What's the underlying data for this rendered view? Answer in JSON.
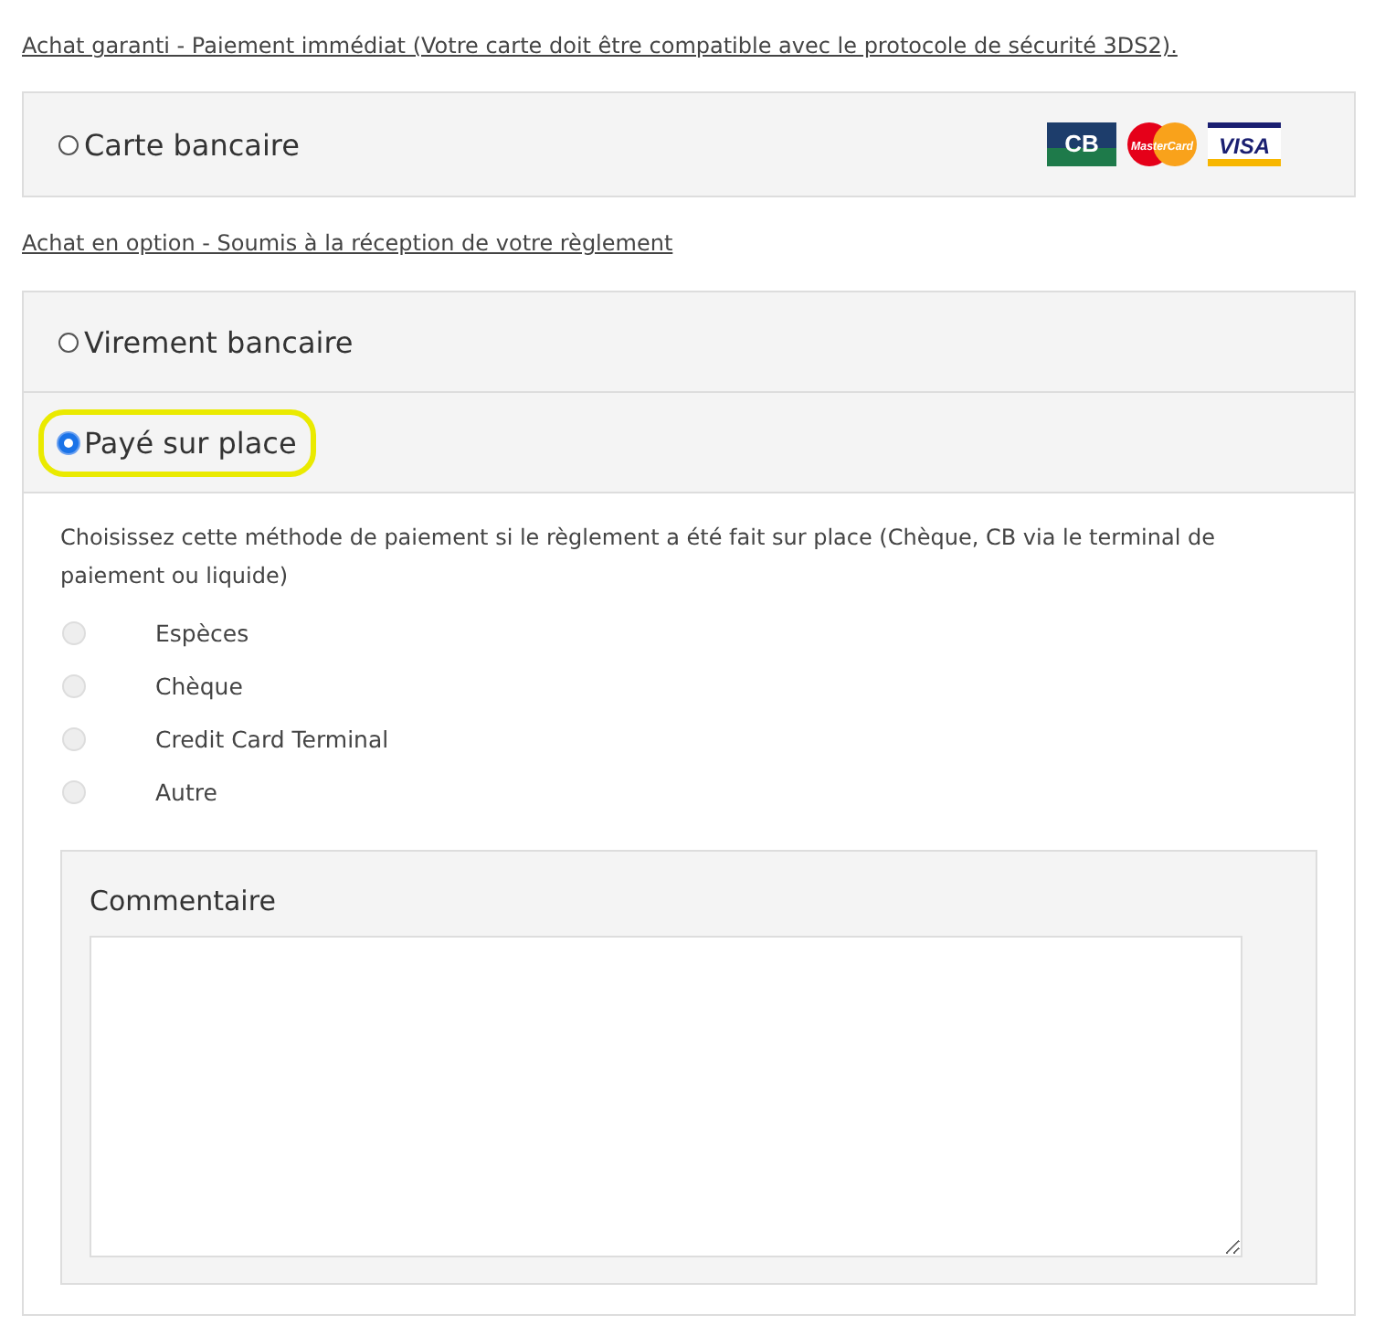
{
  "guaranteed_link": "Achat garanti - Paiement immédiat (Votre carte doit être compatible avec le protocole de sécurité 3DS2).",
  "card_option": {
    "label": "Carte bancaire",
    "selected": false,
    "logos": [
      {
        "kind": "cb",
        "text": "CB"
      },
      {
        "kind": "mastercard",
        "text": "MasterCard"
      },
      {
        "kind": "visa",
        "text": "VISA"
      }
    ]
  },
  "optional_link": "Achat en option - Soumis à la réception de votre règlement",
  "methods": [
    {
      "label": "Virement bancaire",
      "selected": false,
      "highlighted": false
    },
    {
      "label": "Payé sur place",
      "selected": true,
      "highlighted": true
    }
  ],
  "onsite": {
    "description": "Choisissez cette méthode de paiement si le règlement a été fait sur place (Chèque, CB via le terminal de paiement ou liquide)",
    "choices": [
      {
        "label": "Espèces",
        "selected": false,
        "disabled": true
      },
      {
        "label": "Chèque",
        "selected": false,
        "disabled": true
      },
      {
        "label": "Credit Card Terminal",
        "selected": false,
        "disabled": true
      },
      {
        "label": "Autre",
        "selected": false,
        "disabled": true
      }
    ],
    "comment_label": "Commentaire"
  }
}
